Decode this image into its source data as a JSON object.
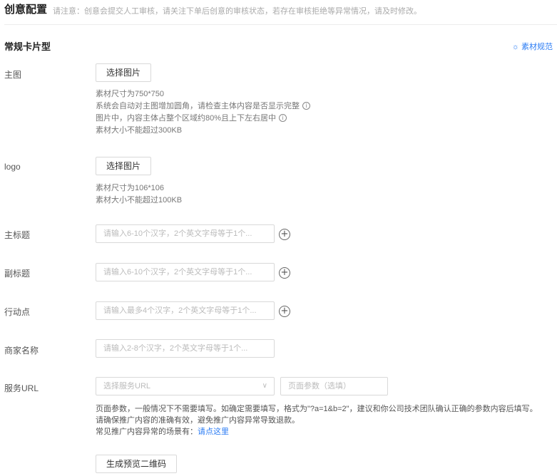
{
  "header": {
    "title": "创意配置",
    "note": "请注意：创意会提交人工审核，请关注下单后创意的审核状态，若存在审核拒绝等异常情况，请及时修改。"
  },
  "section": {
    "title": "常规卡片型",
    "spec_link": "素材规范",
    "spec_icon": "lightbulb-icon"
  },
  "main_image": {
    "label": "主图",
    "button": "选择图片",
    "hints": [
      "素材尺寸为750*750",
      "系统会自动对主图增加圆角，请检查主体内容是否显示完整",
      "图片中，内容主体占整个区域约80%且上下左右居中",
      "素材大小不能超过300KB"
    ]
  },
  "logo": {
    "label": "logo",
    "button": "选择图片",
    "hints": [
      "素材尺寸为106*106",
      "素材大小不能超过100KB"
    ]
  },
  "main_title": {
    "label": "主标题",
    "placeholder": "请输入6-10个汉字，2个英文字母等于1个..."
  },
  "sub_title": {
    "label": "副标题",
    "placeholder": "请输入6-10个汉字，2个英文字母等于1个..."
  },
  "action": {
    "label": "行动点",
    "placeholder": "请输入最多4个汉字，2个英文字母等于1个..."
  },
  "merchant": {
    "label": "商家名称",
    "placeholder": "请输入2-8个汉字，2个英文字母等于1个..."
  },
  "service_url": {
    "label": "服务URL",
    "select_placeholder": "选择服务URL",
    "param_placeholder": "页面参数（选填）",
    "desc_line1": "页面参数，一般情况下不需要填写。如确定需要填写，格式为\"?a=1&b=2\"，建议和你公司技术团队确认正确的参数内容后填写。",
    "desc_line2": "请确保推广内容的准确有效，避免推广内容异常导致退款。",
    "desc_line3_prefix": "常见推广内容异常的场景有：",
    "desc_link": "请点这里",
    "qr_button": "生成预览二维码"
  },
  "icons": {
    "info": "ⓘ",
    "plus": "+",
    "chevron": "∨",
    "bulb": "☼"
  },
  "colors": {
    "link": "#2b7cf4",
    "border": "#d9d9d9"
  }
}
